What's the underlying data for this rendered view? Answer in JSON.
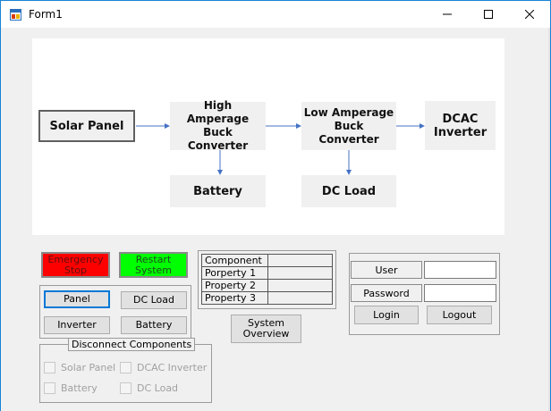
{
  "window": {
    "title": "Form1"
  },
  "diagram": {
    "solar_panel": "Solar Panel",
    "high_buck": "High Amperage Buck Converter",
    "low_buck": "Low Amperage Buck Converter",
    "inverter": "DCAC Inverter",
    "battery": "Battery",
    "dc_load": "DC Load"
  },
  "controls": {
    "emergency_stop": "Emergency Stop",
    "restart_system": "Restart System",
    "panel": "Panel",
    "dc_load": "DC Load",
    "inverter": "Inverter",
    "battery": "Battery",
    "system_overview": "System Overview"
  },
  "properties": {
    "rows": [
      "Component",
      "Porperty 1",
      "Property 2",
      "Property 3"
    ]
  },
  "disconnect": {
    "title": "Disconnect Components",
    "items": [
      "Solar Panel",
      "DCAC Inverter",
      "Battery",
      "DC Load"
    ]
  },
  "login": {
    "user_label": "User",
    "password_label": "Password",
    "user_value": "",
    "password_value": "",
    "login_button": "Login",
    "logout_button": "Logout"
  },
  "colors": {
    "emergency": "#ff0000",
    "restart": "#00ff00",
    "arrow": "#4472c4",
    "focus": "#0078d7"
  }
}
